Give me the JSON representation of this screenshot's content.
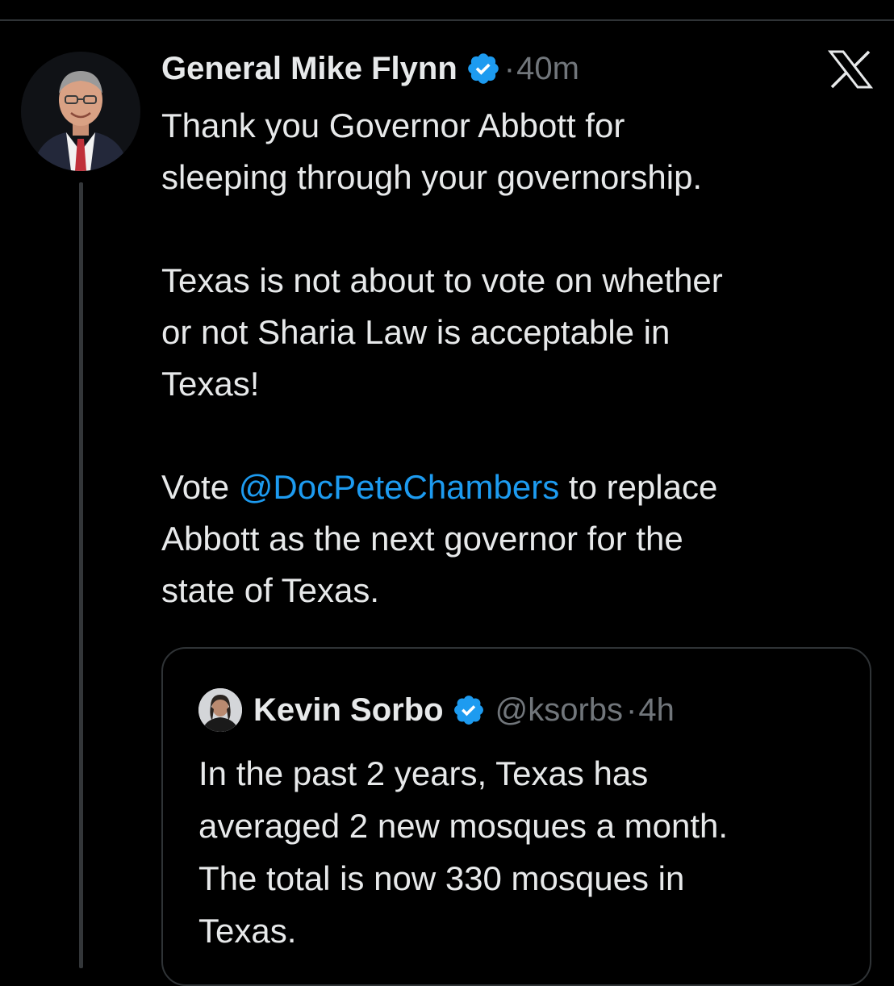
{
  "tweet": {
    "author_name": "General Mike Flynn",
    "separator": "·",
    "time": "40m",
    "platform_icon": "x-logo-icon",
    "verified_icon": "verified-badge-icon",
    "text_line_1": "Thank you Governor Abbott for",
    "text_line_2": "sleeping through your governorship.",
    "text_line_3": "Texas is not about to vote on whether",
    "text_line_4": "or not Sharia Law is acceptable in",
    "text_line_5": "Texas!",
    "vote_prefix": "Vote ",
    "mention": "@DocPeteChambers",
    "vote_suffix": " to replace",
    "text_line_7": "Abbott as the next governor for the",
    "text_line_8": "state of Texas."
  },
  "quote": {
    "author_name": "Kevin Sorbo",
    "handle": "@ksorbs",
    "separator": "·",
    "time": "4h",
    "verified_icon": "verified-badge-icon",
    "text_line_1": "In the past 2 years, Texas has",
    "text_line_2": "averaged 2 new mosques a month.",
    "text_line_3": "The total is now 330 mosques in",
    "text_line_4": "Texas."
  },
  "colors": {
    "background": "#000000",
    "primary_text": "#e7e9ea",
    "secondary_text": "#71767b",
    "link": "#1d9bf0",
    "verified": "#1d9bf0",
    "border": "#2f3336"
  }
}
